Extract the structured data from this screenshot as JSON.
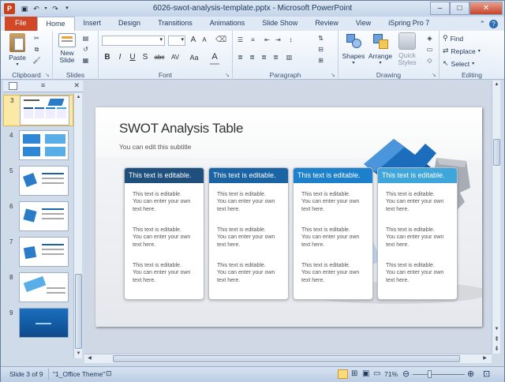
{
  "window": {
    "title": "6026-swot-analysis-template.pptx - Microsoft PowerPoint",
    "app_icon": "P"
  },
  "tabs": [
    "File",
    "Home",
    "Insert",
    "Design",
    "Transitions",
    "Animations",
    "Slide Show",
    "Review",
    "View",
    "iSpring Pro 7"
  ],
  "active_tab": "Home",
  "ribbon": {
    "clipboard": {
      "label": "Clipboard",
      "paste": "Paste"
    },
    "slides": {
      "label": "Slides",
      "new_slide": "New",
      "new_slide2": "Slide"
    },
    "font": {
      "label": "Font",
      "size_grow": "A",
      "size_shrink": "A",
      "buttons": [
        "B",
        "I",
        "U",
        "S",
        "abc",
        "AV",
        "Aa",
        "A"
      ]
    },
    "paragraph": {
      "label": "Paragraph"
    },
    "drawing": {
      "label": "Drawing",
      "shapes": "Shapes",
      "arrange": "Arrange",
      "quick_styles": "Quick",
      "quick_styles2": "Styles"
    },
    "editing": {
      "label": "Editing",
      "find": "Find",
      "replace": "Replace",
      "select": "Select"
    }
  },
  "thumbnails": [
    {
      "num": "3",
      "selected": true
    },
    {
      "num": "4",
      "selected": false
    },
    {
      "num": "5",
      "selected": false
    },
    {
      "num": "6",
      "selected": false
    },
    {
      "num": "7",
      "selected": false
    },
    {
      "num": "8",
      "selected": false
    },
    {
      "num": "9",
      "selected": false
    }
  ],
  "slide": {
    "title": "SWOT Analysis Table",
    "subtitle": "You can edit this subtitle",
    "cards": [
      {
        "header": "This text is editable.",
        "color": "#1f4f7d",
        "blocks": [
          "This text is editable.",
          "You can enter your own",
          "text here."
        ]
      },
      {
        "header": "This text is editable.",
        "color": "#1a63a5",
        "blocks": [
          "This text is editable.",
          "You can enter your own",
          "text here."
        ]
      },
      {
        "header": "This text is editable.",
        "color": "#1c80cc",
        "blocks": [
          "This text is editable.",
          "You can enter your own",
          "text here."
        ]
      },
      {
        "header": "This text is editable.",
        "color": "#3fa6dc",
        "blocks": [
          "This text is editable.",
          "You can enter your own",
          "text here."
        ]
      }
    ]
  },
  "status": {
    "slide": "Slide 3 of 9",
    "theme": "\"1_Office Theme\"",
    "zoom": "71%"
  },
  "colors": {
    "file_tab": "#d24726",
    "accent": "#1e395b"
  }
}
